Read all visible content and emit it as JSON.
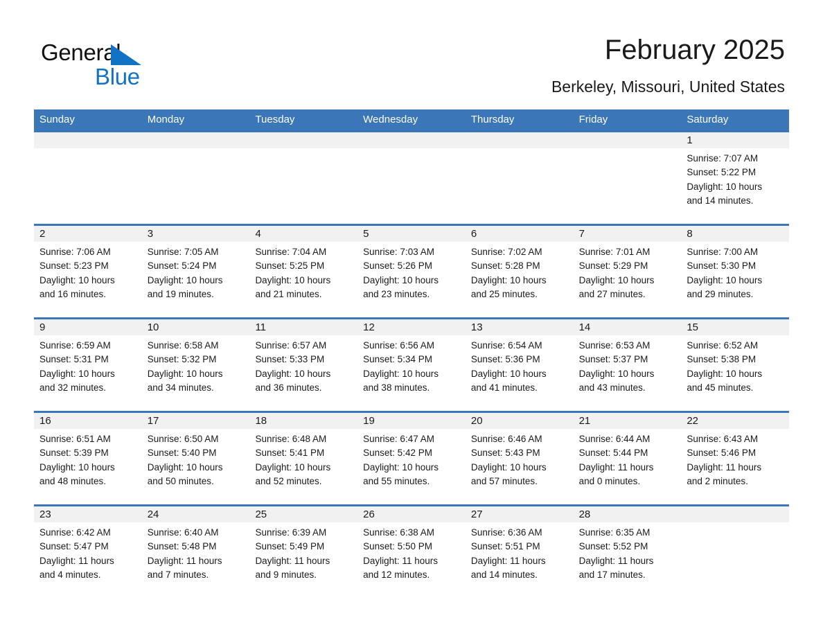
{
  "brand": {
    "name_part1": "General",
    "name_part2": "Blue",
    "triangle_color": "#1273c4",
    "blue_text_color": "#1273c4"
  },
  "header": {
    "title": "February 2025",
    "subtitle": "Berkeley, Missouri, United States"
  },
  "theme": {
    "header_blue": "#3a76b8",
    "date_band_gray": "#f1f1f1",
    "text_color": "#1a1a1a",
    "page_background": "#ffffff"
  },
  "calendar": {
    "weekdays": [
      "Sunday",
      "Monday",
      "Tuesday",
      "Wednesday",
      "Thursday",
      "Friday",
      "Saturday"
    ],
    "weeks": [
      [
        {
          "day": "",
          "lines": []
        },
        {
          "day": "",
          "lines": []
        },
        {
          "day": "",
          "lines": []
        },
        {
          "day": "",
          "lines": []
        },
        {
          "day": "",
          "lines": []
        },
        {
          "day": "",
          "lines": []
        },
        {
          "day": "1",
          "lines": [
            "Sunrise: 7:07 AM",
            "Sunset: 5:22 PM",
            "Daylight: 10 hours",
            "and 14 minutes."
          ]
        }
      ],
      [
        {
          "day": "2",
          "lines": [
            "Sunrise: 7:06 AM",
            "Sunset: 5:23 PM",
            "Daylight: 10 hours",
            "and 16 minutes."
          ]
        },
        {
          "day": "3",
          "lines": [
            "Sunrise: 7:05 AM",
            "Sunset: 5:24 PM",
            "Daylight: 10 hours",
            "and 19 minutes."
          ]
        },
        {
          "day": "4",
          "lines": [
            "Sunrise: 7:04 AM",
            "Sunset: 5:25 PM",
            "Daylight: 10 hours",
            "and 21 minutes."
          ]
        },
        {
          "day": "5",
          "lines": [
            "Sunrise: 7:03 AM",
            "Sunset: 5:26 PM",
            "Daylight: 10 hours",
            "and 23 minutes."
          ]
        },
        {
          "day": "6",
          "lines": [
            "Sunrise: 7:02 AM",
            "Sunset: 5:28 PM",
            "Daylight: 10 hours",
            "and 25 minutes."
          ]
        },
        {
          "day": "7",
          "lines": [
            "Sunrise: 7:01 AM",
            "Sunset: 5:29 PM",
            "Daylight: 10 hours",
            "and 27 minutes."
          ]
        },
        {
          "day": "8",
          "lines": [
            "Sunrise: 7:00 AM",
            "Sunset: 5:30 PM",
            "Daylight: 10 hours",
            "and 29 minutes."
          ]
        }
      ],
      [
        {
          "day": "9",
          "lines": [
            "Sunrise: 6:59 AM",
            "Sunset: 5:31 PM",
            "Daylight: 10 hours",
            "and 32 minutes."
          ]
        },
        {
          "day": "10",
          "lines": [
            "Sunrise: 6:58 AM",
            "Sunset: 5:32 PM",
            "Daylight: 10 hours",
            "and 34 minutes."
          ]
        },
        {
          "day": "11",
          "lines": [
            "Sunrise: 6:57 AM",
            "Sunset: 5:33 PM",
            "Daylight: 10 hours",
            "and 36 minutes."
          ]
        },
        {
          "day": "12",
          "lines": [
            "Sunrise: 6:56 AM",
            "Sunset: 5:34 PM",
            "Daylight: 10 hours",
            "and 38 minutes."
          ]
        },
        {
          "day": "13",
          "lines": [
            "Sunrise: 6:54 AM",
            "Sunset: 5:36 PM",
            "Daylight: 10 hours",
            "and 41 minutes."
          ]
        },
        {
          "day": "14",
          "lines": [
            "Sunrise: 6:53 AM",
            "Sunset: 5:37 PM",
            "Daylight: 10 hours",
            "and 43 minutes."
          ]
        },
        {
          "day": "15",
          "lines": [
            "Sunrise: 6:52 AM",
            "Sunset: 5:38 PM",
            "Daylight: 10 hours",
            "and 45 minutes."
          ]
        }
      ],
      [
        {
          "day": "16",
          "lines": [
            "Sunrise: 6:51 AM",
            "Sunset: 5:39 PM",
            "Daylight: 10 hours",
            "and 48 minutes."
          ]
        },
        {
          "day": "17",
          "lines": [
            "Sunrise: 6:50 AM",
            "Sunset: 5:40 PM",
            "Daylight: 10 hours",
            "and 50 minutes."
          ]
        },
        {
          "day": "18",
          "lines": [
            "Sunrise: 6:48 AM",
            "Sunset: 5:41 PM",
            "Daylight: 10 hours",
            "and 52 minutes."
          ]
        },
        {
          "day": "19",
          "lines": [
            "Sunrise: 6:47 AM",
            "Sunset: 5:42 PM",
            "Daylight: 10 hours",
            "and 55 minutes."
          ]
        },
        {
          "day": "20",
          "lines": [
            "Sunrise: 6:46 AM",
            "Sunset: 5:43 PM",
            "Daylight: 10 hours",
            "and 57 minutes."
          ]
        },
        {
          "day": "21",
          "lines": [
            "Sunrise: 6:44 AM",
            "Sunset: 5:44 PM",
            "Daylight: 11 hours",
            "and 0 minutes."
          ]
        },
        {
          "day": "22",
          "lines": [
            "Sunrise: 6:43 AM",
            "Sunset: 5:46 PM",
            "Daylight: 11 hours",
            "and 2 minutes."
          ]
        }
      ],
      [
        {
          "day": "23",
          "lines": [
            "Sunrise: 6:42 AM",
            "Sunset: 5:47 PM",
            "Daylight: 11 hours",
            "and 4 minutes."
          ]
        },
        {
          "day": "24",
          "lines": [
            "Sunrise: 6:40 AM",
            "Sunset: 5:48 PM",
            "Daylight: 11 hours",
            "and 7 minutes."
          ]
        },
        {
          "day": "25",
          "lines": [
            "Sunrise: 6:39 AM",
            "Sunset: 5:49 PM",
            "Daylight: 11 hours",
            "and 9 minutes."
          ]
        },
        {
          "day": "26",
          "lines": [
            "Sunrise: 6:38 AM",
            "Sunset: 5:50 PM",
            "Daylight: 11 hours",
            "and 12 minutes."
          ]
        },
        {
          "day": "27",
          "lines": [
            "Sunrise: 6:36 AM",
            "Sunset: 5:51 PM",
            "Daylight: 11 hours",
            "and 14 minutes."
          ]
        },
        {
          "day": "28",
          "lines": [
            "Sunrise: 6:35 AM",
            "Sunset: 5:52 PM",
            "Daylight: 11 hours",
            "and 17 minutes."
          ]
        },
        {
          "day": "",
          "lines": []
        }
      ]
    ]
  }
}
